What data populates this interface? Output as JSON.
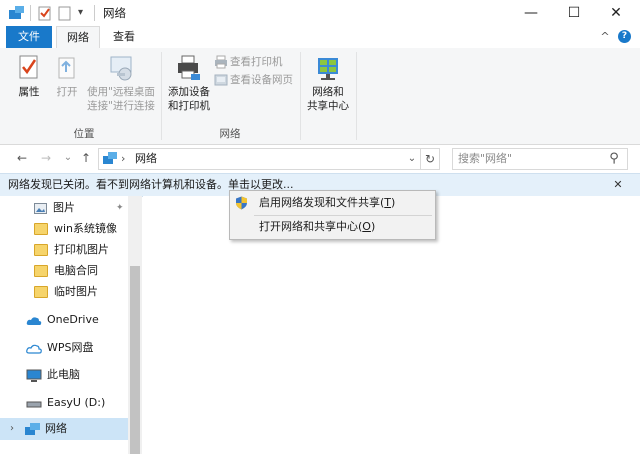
{
  "window": {
    "title": "网络",
    "minimize_glyph": "—",
    "maximize_glyph": "☐",
    "close_glyph": "✕",
    "quick_access_glyph": "▾"
  },
  "ribbon_tabs": {
    "file": "文件",
    "network": "网络",
    "view": "查看"
  },
  "ribbon": {
    "collapse_glyph": "^",
    "help_glyph": "?",
    "location_group": {
      "label": "位置",
      "properties": "属性",
      "open": "打开",
      "remote_desktop_line1": "使用\"远程桌面",
      "remote_desktop_line2": "连接\"进行连接"
    },
    "network_group": {
      "label": "网络",
      "add_devices_line1": "添加设备",
      "add_devices_line2": "和打印机",
      "view_printers": "查看打印机",
      "view_device_webpage": "查看设备网页"
    },
    "sharing_center_line1": "网络和",
    "sharing_center_line2": "共享中心"
  },
  "address": {
    "back_glyph": "←",
    "forward_glyph": "→",
    "recent_glyph": "⌄",
    "up_glyph": "↑",
    "separator": "›",
    "path": "网络",
    "dropdown_glyph": "⌄",
    "refresh_glyph": "↻",
    "search_placeholder": "搜索\"网络\"",
    "search_glyph": "⚲"
  },
  "infobar": {
    "message": "网络发现已关闭。看不到网络计算机和设备。单击以更改...",
    "close_glyph": "✕"
  },
  "nav_pane": {
    "items": [
      {
        "label": "图片",
        "pin_glyph": "📌"
      },
      {
        "label": "win系统镜像"
      },
      {
        "label": "打印机图片"
      },
      {
        "label": "电脑合同"
      },
      {
        "label": "临时图片"
      },
      {
        "label": "OneDrive"
      },
      {
        "label": "WPS网盘"
      },
      {
        "label": "此电脑"
      },
      {
        "label": "EasyU (D:)"
      },
      {
        "label": "网络"
      }
    ],
    "expand_glyph": "›"
  },
  "context_menu": {
    "item1_text": "启用网络发现和文件共享(",
    "item1_key": "T",
    "item1_close": ")",
    "item2_text": "打开网络和共享中心(",
    "item2_key": "O",
    "item2_close": ")"
  },
  "colors": {
    "accent": "#1979ca",
    "infobar_bg": "#e4f0fa",
    "ribbon_bg": "#f5f6f7",
    "selected_nav_bg": "#cce4f7"
  }
}
